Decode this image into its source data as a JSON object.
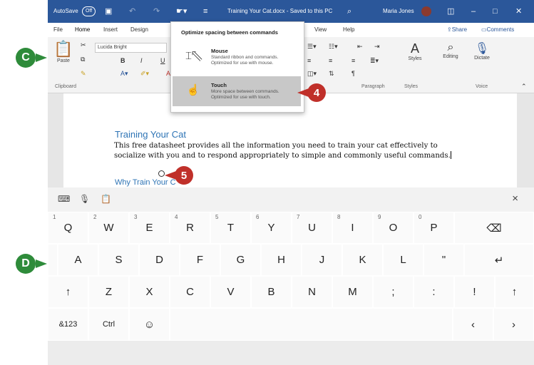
{
  "titlebar": {
    "autosave_label": "AutoSave",
    "autosave_state": "Off",
    "doc_title": "Training Your Cat.docx  -  Saved to this PC",
    "user_name": "Maria Jones"
  },
  "tabs": [
    "File",
    "Home",
    "Insert",
    "Design",
    "View",
    "Help"
  ],
  "share_label": "Share",
  "comments_label": "Comments",
  "ribbon": {
    "paste_label": "Paste",
    "font_name": "Lucida Bright",
    "styles_label": "Styles",
    "editing_label": "Editing",
    "dictate_label": "Dictate",
    "group_clipboard": "Clipboard",
    "group_paragraph": "Paragraph",
    "group_styles": "Styles",
    "group_voice": "Voice"
  },
  "dropdown": {
    "title": "Optimize spacing between commands",
    "mouse_title": "Mouse",
    "mouse_desc": "Standard ribbon and commands. Optimized for use with mouse.",
    "touch_title": "Touch",
    "touch_desc": "More space between commands. Optimized for use with touch."
  },
  "document": {
    "heading": "Training Your Cat",
    "paragraph": "This free datasheet provides all the information you need to train your cat effectively to socialize with you and to respond appropriately to simple and commonly useful commands.",
    "subheading": "Why Train Your C"
  },
  "keyboard": {
    "row1": [
      {
        "k": "Q",
        "n": "1"
      },
      {
        "k": "W",
        "n": "2"
      },
      {
        "k": "E",
        "n": "3"
      },
      {
        "k": "R",
        "n": "4"
      },
      {
        "k": "T",
        "n": "5"
      },
      {
        "k": "Y",
        "n": "6"
      },
      {
        "k": "U",
        "n": "7"
      },
      {
        "k": "I",
        "n": "8"
      },
      {
        "k": "O",
        "n": "9"
      },
      {
        "k": "P",
        "n": "0"
      }
    ],
    "row2": [
      "A",
      "S",
      "D",
      "F",
      "G",
      "H",
      "J",
      "K",
      "L",
      "\""
    ],
    "row3": [
      "Z",
      "X",
      "C",
      "V",
      "B",
      "N",
      "M",
      ";",
      ":",
      "!"
    ],
    "backspace": "⌫",
    "enter": "↵",
    "shift": "↑",
    "symbols": "&123",
    "ctrl": "Ctrl",
    "emoji": "☺",
    "left": "‹",
    "right": "›",
    "close": "×"
  },
  "callouts": {
    "c": "C",
    "d": "D",
    "four": "4",
    "five": "5"
  },
  "colors": {
    "word_blue": "#2b579a",
    "callout_green": "#2e8b3a",
    "callout_red": "#c0302a"
  }
}
